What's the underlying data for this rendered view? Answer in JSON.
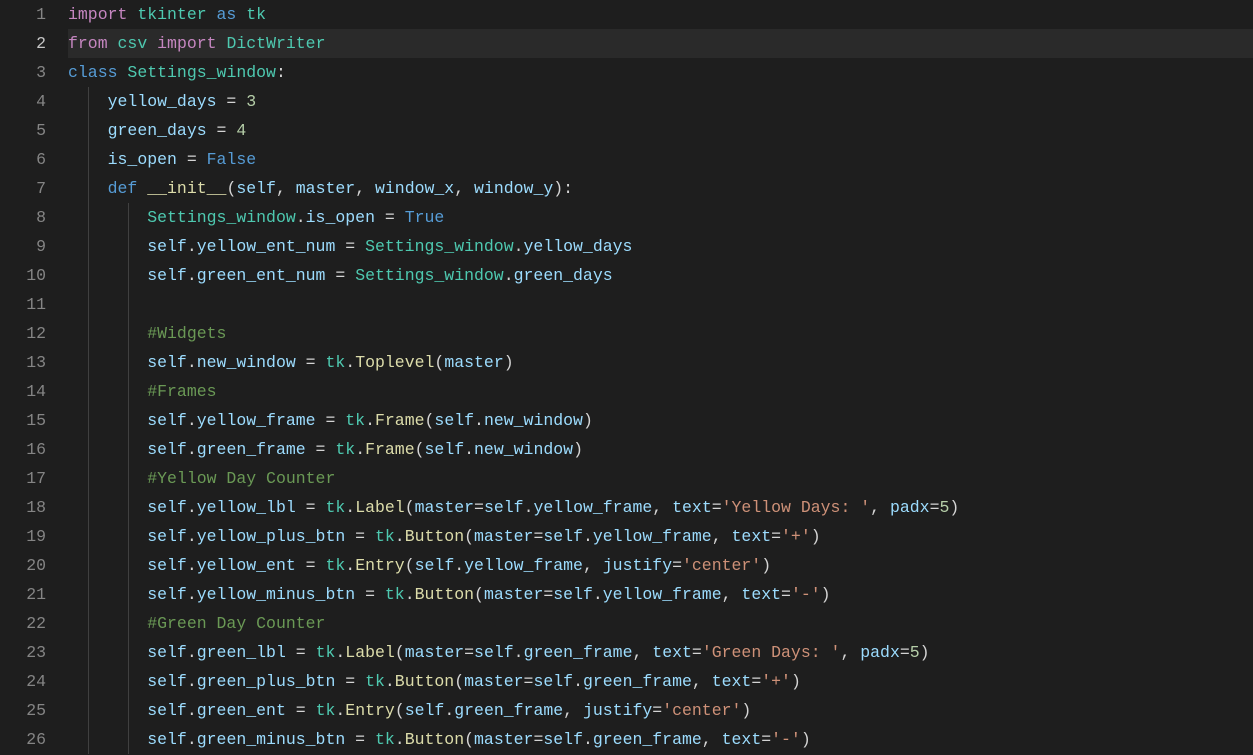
{
  "active_line": 2,
  "lines": [
    {
      "num": 1,
      "indent": 0,
      "tokens": [
        [
          "import ",
          "tk-keyword"
        ],
        [
          "tkinter",
          "tk-module"
        ],
        [
          " ",
          "tk-punct"
        ],
        [
          "as",
          "tk-keyword2"
        ],
        [
          " ",
          "tk-punct"
        ],
        [
          "tk",
          "tk-module"
        ]
      ]
    },
    {
      "num": 2,
      "indent": 0,
      "tokens": [
        [
          "from ",
          "tk-keyword"
        ],
        [
          "csv",
          "tk-module"
        ],
        [
          " ",
          "tk-punct"
        ],
        [
          "import",
          "tk-keyword"
        ],
        [
          " ",
          "tk-punct"
        ],
        [
          "DictWriter",
          "tk-module"
        ]
      ]
    },
    {
      "num": 3,
      "indent": 0,
      "tokens": [
        [
          "class ",
          "tk-keyword2"
        ],
        [
          "Settings_window",
          "tk-module"
        ],
        [
          ":",
          "tk-punct"
        ]
      ]
    },
    {
      "num": 4,
      "indent": 1,
      "tokens": [
        [
          "yellow_days",
          "tk-var"
        ],
        [
          " = ",
          "tk-op"
        ],
        [
          "3",
          "tk-number"
        ]
      ]
    },
    {
      "num": 5,
      "indent": 1,
      "tokens": [
        [
          "green_days",
          "tk-var"
        ],
        [
          " = ",
          "tk-op"
        ],
        [
          "4",
          "tk-number"
        ]
      ]
    },
    {
      "num": 6,
      "indent": 1,
      "tokens": [
        [
          "is_open",
          "tk-var"
        ],
        [
          " = ",
          "tk-op"
        ],
        [
          "False",
          "tk-const"
        ]
      ]
    },
    {
      "num": 7,
      "indent": 1,
      "tokens": [
        [
          "def ",
          "tk-keyword2"
        ],
        [
          "__init__",
          "tk-dunder"
        ],
        [
          "(",
          "tk-punct"
        ],
        [
          "self",
          "tk-self"
        ],
        [
          ", ",
          "tk-punct"
        ],
        [
          "master",
          "tk-param"
        ],
        [
          ", ",
          "tk-punct"
        ],
        [
          "window_x",
          "tk-param"
        ],
        [
          ", ",
          "tk-punct"
        ],
        [
          "window_y",
          "tk-param"
        ],
        [
          "):",
          "tk-punct"
        ]
      ]
    },
    {
      "num": 8,
      "indent": 2,
      "tokens": [
        [
          "Settings_window",
          "tk-module"
        ],
        [
          ".",
          "tk-punct"
        ],
        [
          "is_open",
          "tk-prop"
        ],
        [
          " = ",
          "tk-op"
        ],
        [
          "True",
          "tk-const"
        ]
      ]
    },
    {
      "num": 9,
      "indent": 2,
      "tokens": [
        [
          "self",
          "tk-self"
        ],
        [
          ".",
          "tk-punct"
        ],
        [
          "yellow_ent_num",
          "tk-prop"
        ],
        [
          " = ",
          "tk-op"
        ],
        [
          "Settings_window",
          "tk-module"
        ],
        [
          ".",
          "tk-punct"
        ],
        [
          "yellow_days",
          "tk-prop"
        ]
      ]
    },
    {
      "num": 10,
      "indent": 2,
      "tokens": [
        [
          "self",
          "tk-self"
        ],
        [
          ".",
          "tk-punct"
        ],
        [
          "green_ent_num",
          "tk-prop"
        ],
        [
          " = ",
          "tk-op"
        ],
        [
          "Settings_window",
          "tk-module"
        ],
        [
          ".",
          "tk-punct"
        ],
        [
          "green_days",
          "tk-prop"
        ]
      ]
    },
    {
      "num": 11,
      "indent": 2,
      "tokens": []
    },
    {
      "num": 12,
      "indent": 2,
      "tokens": [
        [
          "#Widgets",
          "tk-comment"
        ]
      ]
    },
    {
      "num": 13,
      "indent": 2,
      "tokens": [
        [
          "self",
          "tk-self"
        ],
        [
          ".",
          "tk-punct"
        ],
        [
          "new_window",
          "tk-prop"
        ],
        [
          " = ",
          "tk-op"
        ],
        [
          "tk",
          "tk-module"
        ],
        [
          ".",
          "tk-punct"
        ],
        [
          "Toplevel",
          "tk-func"
        ],
        [
          "(",
          "tk-punct"
        ],
        [
          "master",
          "tk-var"
        ],
        [
          ")",
          "tk-punct"
        ]
      ]
    },
    {
      "num": 14,
      "indent": 2,
      "tokens": [
        [
          "#Frames",
          "tk-comment"
        ]
      ]
    },
    {
      "num": 15,
      "indent": 2,
      "tokens": [
        [
          "self",
          "tk-self"
        ],
        [
          ".",
          "tk-punct"
        ],
        [
          "yellow_frame",
          "tk-prop"
        ],
        [
          " = ",
          "tk-op"
        ],
        [
          "tk",
          "tk-module"
        ],
        [
          ".",
          "tk-punct"
        ],
        [
          "Frame",
          "tk-func"
        ],
        [
          "(",
          "tk-punct"
        ],
        [
          "self",
          "tk-self"
        ],
        [
          ".",
          "tk-punct"
        ],
        [
          "new_window",
          "tk-prop"
        ],
        [
          ")",
          "tk-punct"
        ]
      ]
    },
    {
      "num": 16,
      "indent": 2,
      "tokens": [
        [
          "self",
          "tk-self"
        ],
        [
          ".",
          "tk-punct"
        ],
        [
          "green_frame",
          "tk-prop"
        ],
        [
          " = ",
          "tk-op"
        ],
        [
          "tk",
          "tk-module"
        ],
        [
          ".",
          "tk-punct"
        ],
        [
          "Frame",
          "tk-func"
        ],
        [
          "(",
          "tk-punct"
        ],
        [
          "self",
          "tk-self"
        ],
        [
          ".",
          "tk-punct"
        ],
        [
          "new_window",
          "tk-prop"
        ],
        [
          ")",
          "tk-punct"
        ]
      ]
    },
    {
      "num": 17,
      "indent": 2,
      "tokens": [
        [
          "#Yellow Day Counter",
          "tk-comment"
        ]
      ]
    },
    {
      "num": 18,
      "indent": 2,
      "tokens": [
        [
          "self",
          "tk-self"
        ],
        [
          ".",
          "tk-punct"
        ],
        [
          "yellow_lbl",
          "tk-prop"
        ],
        [
          " = ",
          "tk-op"
        ],
        [
          "tk",
          "tk-module"
        ],
        [
          ".",
          "tk-punct"
        ],
        [
          "Label",
          "tk-func"
        ],
        [
          "(",
          "tk-punct"
        ],
        [
          "master",
          "tk-var"
        ],
        [
          "=",
          "tk-op"
        ],
        [
          "self",
          "tk-self"
        ],
        [
          ".",
          "tk-punct"
        ],
        [
          "yellow_frame",
          "tk-prop"
        ],
        [
          ", ",
          "tk-punct"
        ],
        [
          "text",
          "tk-var"
        ],
        [
          "=",
          "tk-op"
        ],
        [
          "'Yellow Days: '",
          "tk-string"
        ],
        [
          ", ",
          "tk-punct"
        ],
        [
          "padx",
          "tk-var"
        ],
        [
          "=",
          "tk-op"
        ],
        [
          "5",
          "tk-number"
        ],
        [
          ")",
          "tk-punct"
        ]
      ]
    },
    {
      "num": 19,
      "indent": 2,
      "tokens": [
        [
          "self",
          "tk-self"
        ],
        [
          ".",
          "tk-punct"
        ],
        [
          "yellow_plus_btn",
          "tk-prop"
        ],
        [
          " = ",
          "tk-op"
        ],
        [
          "tk",
          "tk-module"
        ],
        [
          ".",
          "tk-punct"
        ],
        [
          "Button",
          "tk-func"
        ],
        [
          "(",
          "tk-punct"
        ],
        [
          "master",
          "tk-var"
        ],
        [
          "=",
          "tk-op"
        ],
        [
          "self",
          "tk-self"
        ],
        [
          ".",
          "tk-punct"
        ],
        [
          "yellow_frame",
          "tk-prop"
        ],
        [
          ", ",
          "tk-punct"
        ],
        [
          "text",
          "tk-var"
        ],
        [
          "=",
          "tk-op"
        ],
        [
          "'+'",
          "tk-string"
        ],
        [
          ")",
          "tk-punct"
        ]
      ]
    },
    {
      "num": 20,
      "indent": 2,
      "tokens": [
        [
          "self",
          "tk-self"
        ],
        [
          ".",
          "tk-punct"
        ],
        [
          "yellow_ent",
          "tk-prop"
        ],
        [
          " = ",
          "tk-op"
        ],
        [
          "tk",
          "tk-module"
        ],
        [
          ".",
          "tk-punct"
        ],
        [
          "Entry",
          "tk-func"
        ],
        [
          "(",
          "tk-punct"
        ],
        [
          "self",
          "tk-self"
        ],
        [
          ".",
          "tk-punct"
        ],
        [
          "yellow_frame",
          "tk-prop"
        ],
        [
          ", ",
          "tk-punct"
        ],
        [
          "justify",
          "tk-var"
        ],
        [
          "=",
          "tk-op"
        ],
        [
          "'center'",
          "tk-string"
        ],
        [
          ")",
          "tk-punct"
        ]
      ]
    },
    {
      "num": 21,
      "indent": 2,
      "tokens": [
        [
          "self",
          "tk-self"
        ],
        [
          ".",
          "tk-punct"
        ],
        [
          "yellow_minus_btn",
          "tk-prop"
        ],
        [
          " = ",
          "tk-op"
        ],
        [
          "tk",
          "tk-module"
        ],
        [
          ".",
          "tk-punct"
        ],
        [
          "Button",
          "tk-func"
        ],
        [
          "(",
          "tk-punct"
        ],
        [
          "master",
          "tk-var"
        ],
        [
          "=",
          "tk-op"
        ],
        [
          "self",
          "tk-self"
        ],
        [
          ".",
          "tk-punct"
        ],
        [
          "yellow_frame",
          "tk-prop"
        ],
        [
          ", ",
          "tk-punct"
        ],
        [
          "text",
          "tk-var"
        ],
        [
          "=",
          "tk-op"
        ],
        [
          "'-'",
          "tk-string"
        ],
        [
          ")",
          "tk-punct"
        ]
      ]
    },
    {
      "num": 22,
      "indent": 2,
      "tokens": [
        [
          "#Green Day Counter",
          "tk-comment"
        ]
      ]
    },
    {
      "num": 23,
      "indent": 2,
      "tokens": [
        [
          "self",
          "tk-self"
        ],
        [
          ".",
          "tk-punct"
        ],
        [
          "green_lbl",
          "tk-prop"
        ],
        [
          " = ",
          "tk-op"
        ],
        [
          "tk",
          "tk-module"
        ],
        [
          ".",
          "tk-punct"
        ],
        [
          "Label",
          "tk-func"
        ],
        [
          "(",
          "tk-punct"
        ],
        [
          "master",
          "tk-var"
        ],
        [
          "=",
          "tk-op"
        ],
        [
          "self",
          "tk-self"
        ],
        [
          ".",
          "tk-punct"
        ],
        [
          "green_frame",
          "tk-prop"
        ],
        [
          ", ",
          "tk-punct"
        ],
        [
          "text",
          "tk-var"
        ],
        [
          "=",
          "tk-op"
        ],
        [
          "'Green Days: '",
          "tk-string"
        ],
        [
          ", ",
          "tk-punct"
        ],
        [
          "padx",
          "tk-var"
        ],
        [
          "=",
          "tk-op"
        ],
        [
          "5",
          "tk-number"
        ],
        [
          ")",
          "tk-punct"
        ]
      ]
    },
    {
      "num": 24,
      "indent": 2,
      "tokens": [
        [
          "self",
          "tk-self"
        ],
        [
          ".",
          "tk-punct"
        ],
        [
          "green_plus_btn",
          "tk-prop"
        ],
        [
          " = ",
          "tk-op"
        ],
        [
          "tk",
          "tk-module"
        ],
        [
          ".",
          "tk-punct"
        ],
        [
          "Button",
          "tk-func"
        ],
        [
          "(",
          "tk-punct"
        ],
        [
          "master",
          "tk-var"
        ],
        [
          "=",
          "tk-op"
        ],
        [
          "self",
          "tk-self"
        ],
        [
          ".",
          "tk-punct"
        ],
        [
          "green_frame",
          "tk-prop"
        ],
        [
          ", ",
          "tk-punct"
        ],
        [
          "text",
          "tk-var"
        ],
        [
          "=",
          "tk-op"
        ],
        [
          "'+'",
          "tk-string"
        ],
        [
          ")",
          "tk-punct"
        ]
      ]
    },
    {
      "num": 25,
      "indent": 2,
      "tokens": [
        [
          "self",
          "tk-self"
        ],
        [
          ".",
          "tk-punct"
        ],
        [
          "green_ent",
          "tk-prop"
        ],
        [
          " = ",
          "tk-op"
        ],
        [
          "tk",
          "tk-module"
        ],
        [
          ".",
          "tk-punct"
        ],
        [
          "Entry",
          "tk-func"
        ],
        [
          "(",
          "tk-punct"
        ],
        [
          "self",
          "tk-self"
        ],
        [
          ".",
          "tk-punct"
        ],
        [
          "green_frame",
          "tk-prop"
        ],
        [
          ", ",
          "tk-punct"
        ],
        [
          "justify",
          "tk-var"
        ],
        [
          "=",
          "tk-op"
        ],
        [
          "'center'",
          "tk-string"
        ],
        [
          ")",
          "tk-punct"
        ]
      ]
    },
    {
      "num": 26,
      "indent": 2,
      "tokens": [
        [
          "self",
          "tk-self"
        ],
        [
          ".",
          "tk-punct"
        ],
        [
          "green_minus_btn",
          "tk-prop"
        ],
        [
          " = ",
          "tk-op"
        ],
        [
          "tk",
          "tk-module"
        ],
        [
          ".",
          "tk-punct"
        ],
        [
          "Button",
          "tk-func"
        ],
        [
          "(",
          "tk-punct"
        ],
        [
          "master",
          "tk-var"
        ],
        [
          "=",
          "tk-op"
        ],
        [
          "self",
          "tk-self"
        ],
        [
          ".",
          "tk-punct"
        ],
        [
          "green_frame",
          "tk-prop"
        ],
        [
          ", ",
          "tk-punct"
        ],
        [
          "text",
          "tk-var"
        ],
        [
          "=",
          "tk-op"
        ],
        [
          "'-'",
          "tk-string"
        ],
        [
          ")",
          "tk-punct"
        ]
      ]
    }
  ],
  "indent_unit": "    ",
  "guide_spans": [
    {
      "level": 1,
      "from": 4,
      "to": 26
    },
    {
      "level": 2,
      "from": 8,
      "to": 26
    }
  ],
  "colors": {
    "background": "#1e1e1e",
    "gutter": "#858585",
    "gutter_active": "#c6c6c6",
    "active_line_bg": "#2a2a2a",
    "guide": "#404040"
  }
}
